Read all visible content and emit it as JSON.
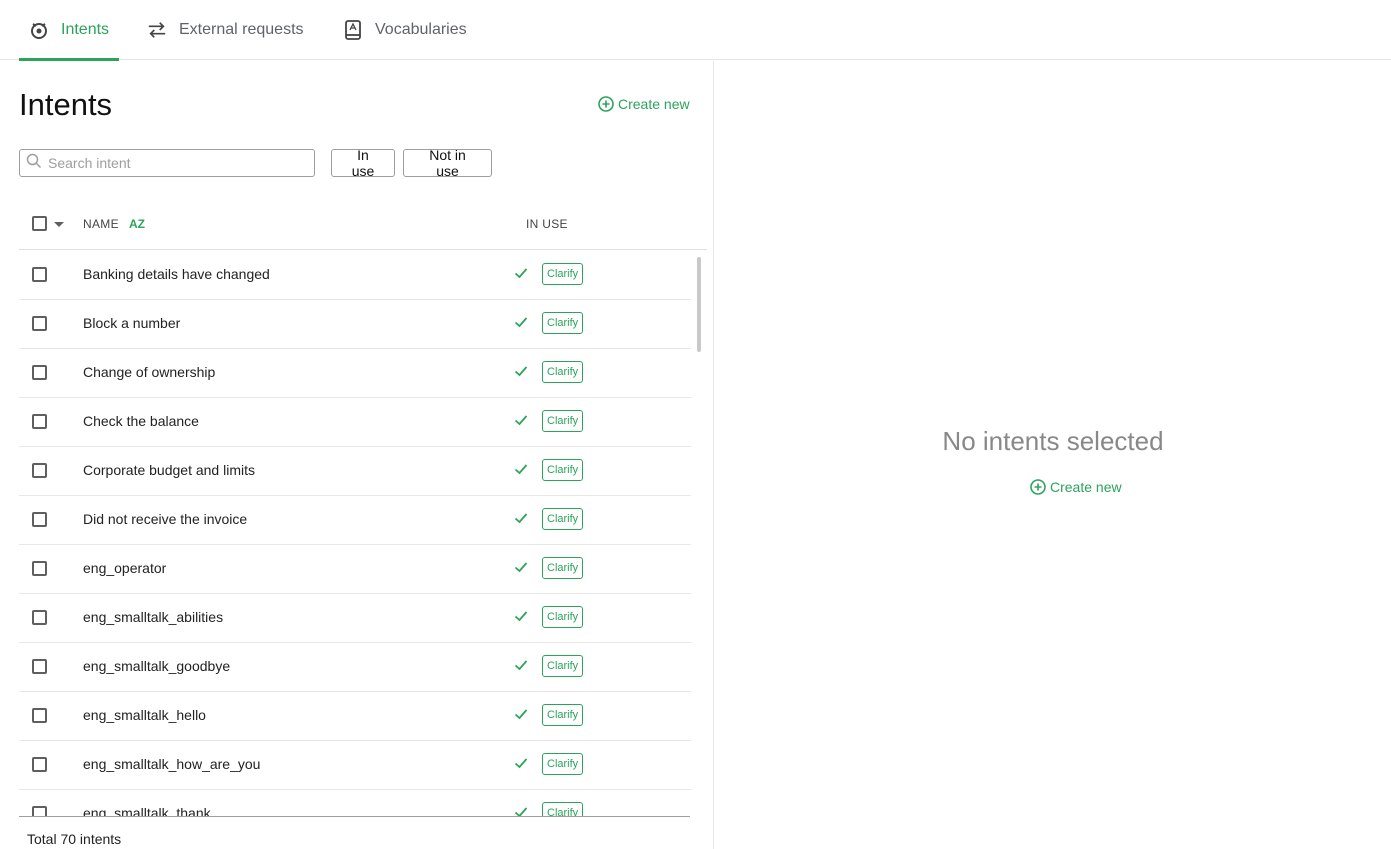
{
  "tabs": [
    {
      "label": "Intents",
      "icon": "intents-icon",
      "active": true
    },
    {
      "label": "External requests",
      "icon": "api-arrows-icon",
      "active": false
    },
    {
      "label": "Vocabularies",
      "icon": "book-icon",
      "active": false
    }
  ],
  "left": {
    "title": "Intents",
    "create_new": "Create new",
    "search_placeholder": "Search intent",
    "filters": [
      "In use",
      "Not in use"
    ],
    "columns": {
      "name": "NAME",
      "in_use": "IN USE"
    },
    "sort_label": "AZ",
    "rows": [
      {
        "name": "Banking details have changed",
        "badge": "Clarify"
      },
      {
        "name": "Block a number",
        "badge": "Clarify"
      },
      {
        "name": "Change of ownership",
        "badge": "Clarify"
      },
      {
        "name": "Check the balance",
        "badge": "Clarify"
      },
      {
        "name": "Corporate budget and limits",
        "badge": "Clarify"
      },
      {
        "name": "Did not receive the invoice",
        "badge": "Clarify"
      },
      {
        "name": "eng_operator",
        "badge": "Clarify"
      },
      {
        "name": "eng_smalltalk_abilities",
        "badge": "Clarify"
      },
      {
        "name": "eng_smalltalk_goodbye",
        "badge": "Clarify"
      },
      {
        "name": "eng_smalltalk_hello",
        "badge": "Clarify"
      },
      {
        "name": "eng_smalltalk_how_are_you",
        "badge": "Clarify"
      },
      {
        "name": "eng_smalltalk_thank",
        "badge": "Clarify"
      }
    ],
    "total": "Total 70 intents"
  },
  "right": {
    "empty_title": "No intents selected",
    "create_new": "Create new"
  },
  "colors": {
    "accent": "#2ba45b",
    "muted": "#888888"
  }
}
